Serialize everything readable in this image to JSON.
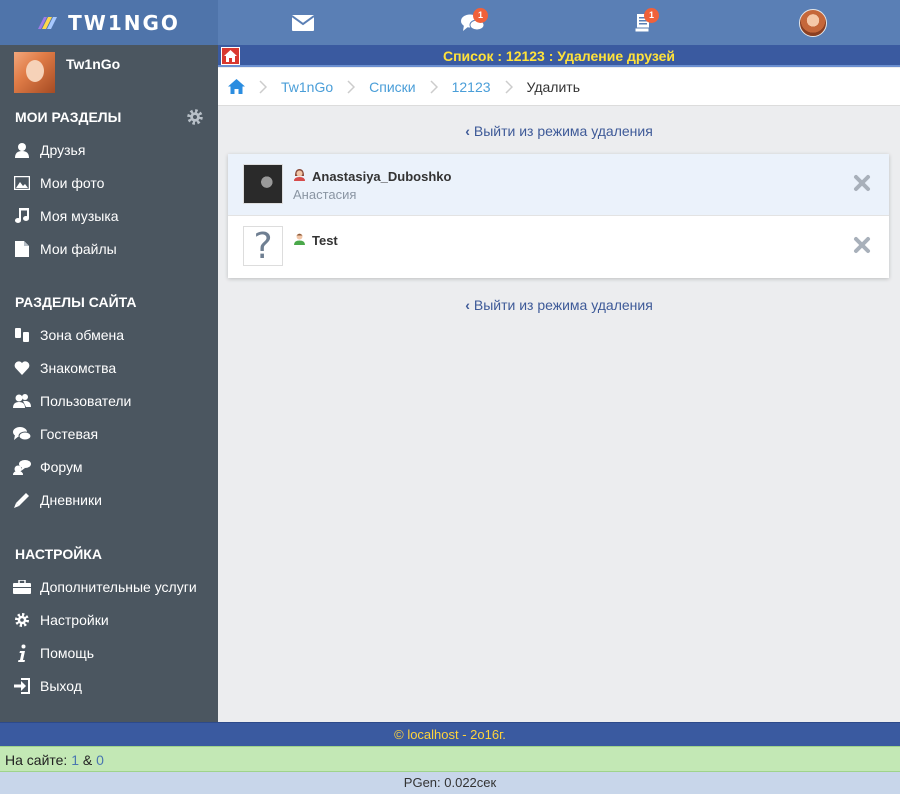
{
  "app": {
    "logo_text": "TW1NGO"
  },
  "topbar": {
    "mail_icon": "envelope-icon",
    "chat_badge": "1",
    "notif_badge": "1"
  },
  "sidebar": {
    "profile_name": "Tw1nGo",
    "sections": {
      "my": "МОИ РАЗДЕЛЫ",
      "site": "РАЗДЕЛЫ САЙТА",
      "settings": "НАСТРОЙКА"
    },
    "my_items": [
      "Друзья",
      "Мои фото",
      "Моя музыка",
      "Мои файлы"
    ],
    "site_items": [
      "Зона обмена",
      "Знакомства",
      "Пользователи",
      "Гостевая",
      "Форум",
      "Дневники"
    ],
    "settings_items": [
      "Дополнительные услуги",
      "Настройки",
      "Помощь",
      "Выход"
    ]
  },
  "main": {
    "title": "Список : 12123 : Удаление друзей",
    "breadcrumb": [
      "Tw1nGo",
      "Списки",
      "12123"
    ],
    "breadcrumb_current": "Удалить",
    "exit_link": "Выйти из режима удаления",
    "rows": [
      {
        "name": "Anastasiya_Duboshko",
        "sub": "Анастасия"
      },
      {
        "name": "Test",
        "sub": ""
      }
    ],
    "unknown_avatar_glyph": "?"
  },
  "footer": {
    "copyright": "© localhost - 2o16г.",
    "online_label": "На сайте:",
    "online_users": "1",
    "online_sep": "&",
    "online_guests": "0",
    "pgen": "PGen: 0.022сек"
  },
  "colors": {
    "topbar": "#5a7fb5",
    "sidebar": "#4b5660",
    "title_text": "#ffe23a",
    "link": "#3e5a98",
    "footer_online": "#c3e8b5"
  }
}
